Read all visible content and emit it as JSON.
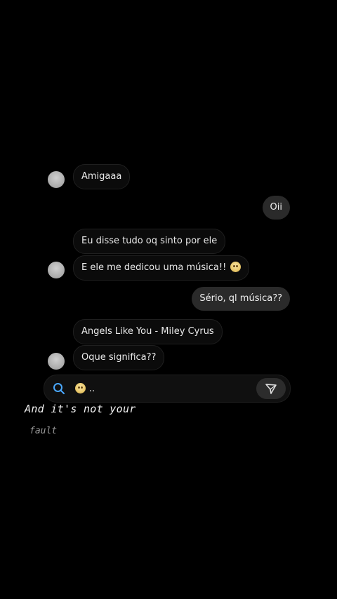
{
  "messages": [
    {
      "text": "Amigaaa"
    },
    {
      "text": "Oii"
    },
    {
      "text": "Eu disse tudo oq sinto por ele"
    },
    {
      "text": "E ele me dedicou uma música!!"
    },
    {
      "text": "Sério, ql música??"
    },
    {
      "text": "Angels Like You - Miley Cyrus"
    },
    {
      "text": "Oque significa??"
    }
  ],
  "composer": {
    "text": "..",
    "icons": {
      "search": "search-icon",
      "emoji": "emoji-icon",
      "send": "send-icon"
    }
  },
  "lyrics": {
    "line1": "And it's not your",
    "line2": "fault"
  },
  "colors": {
    "background": "#000000",
    "incoming_bubble": "#0b0b0b",
    "outgoing_bubble": "#2a2a2a",
    "search_icon": "#4aa8ff"
  }
}
